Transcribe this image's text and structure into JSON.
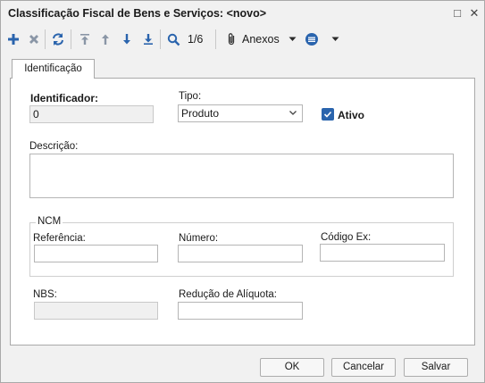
{
  "window": {
    "title": "Classificação Fiscal de Bens e Serviços: <novo>",
    "maximize_glyph": "□",
    "close_glyph": "✕"
  },
  "toolbar": {
    "icons": [
      "add-icon",
      "delete-icon",
      "refresh-icon",
      "first-record-icon",
      "previous-record-icon",
      "next-record-icon",
      "last-record-icon",
      "search-icon",
      "paperclip-icon",
      "list-icon"
    ],
    "record_counter": "1/6",
    "attachments_label": "Anexos",
    "accent_color": "#2a64ad"
  },
  "tabs": [
    {
      "label": "Identificação",
      "active": true
    }
  ],
  "form": {
    "identificador": {
      "label": "Identificador:",
      "value": "0"
    },
    "tipo": {
      "label": "Tipo:",
      "value": "Produto"
    },
    "ativo": {
      "label": "Ativo",
      "checked": true
    },
    "descricao": {
      "label": "Descrição:",
      "value": ""
    },
    "ncm": {
      "legend": "NCM",
      "referencia": {
        "label": "Referência:",
        "value": ""
      },
      "numero": {
        "label": "Número:",
        "value": ""
      },
      "codigo_ex": {
        "label": "Código Ex:",
        "value": ""
      }
    },
    "nbs": {
      "label": "NBS:",
      "value": ""
    },
    "reducao_aliquota": {
      "label": "Redução de Alíquota:",
      "value": ""
    }
  },
  "footer": {
    "ok_label": "OK",
    "cancel_label": "Cancelar",
    "save_label": "Salvar"
  }
}
